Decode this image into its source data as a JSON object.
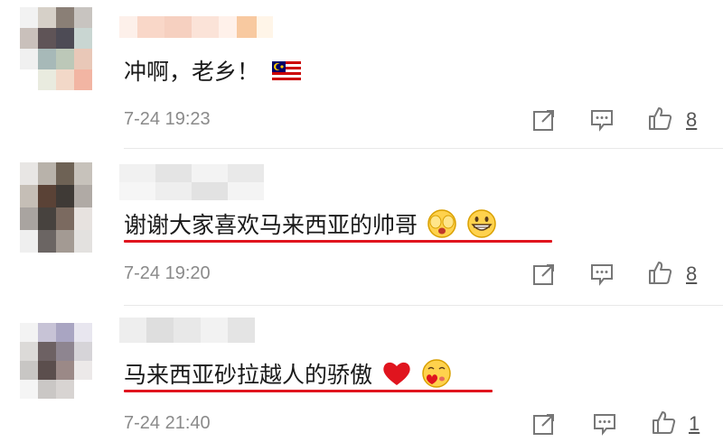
{
  "comments": [
    {
      "text": "冲啊，老乡！",
      "flag": "🇲🇾",
      "time": "7-24 19:23",
      "likes": "8"
    },
    {
      "text": "谢谢大家喜欢马来西亚的帅哥",
      "time": "7-24 19:20",
      "likes": "8"
    },
    {
      "text": "马来西亚砂拉越人的骄傲",
      "time": "7-24 21:40",
      "likes": "1"
    }
  ],
  "colors": {
    "underline": "#e0141e",
    "timestamp": "#8a8a8a"
  }
}
